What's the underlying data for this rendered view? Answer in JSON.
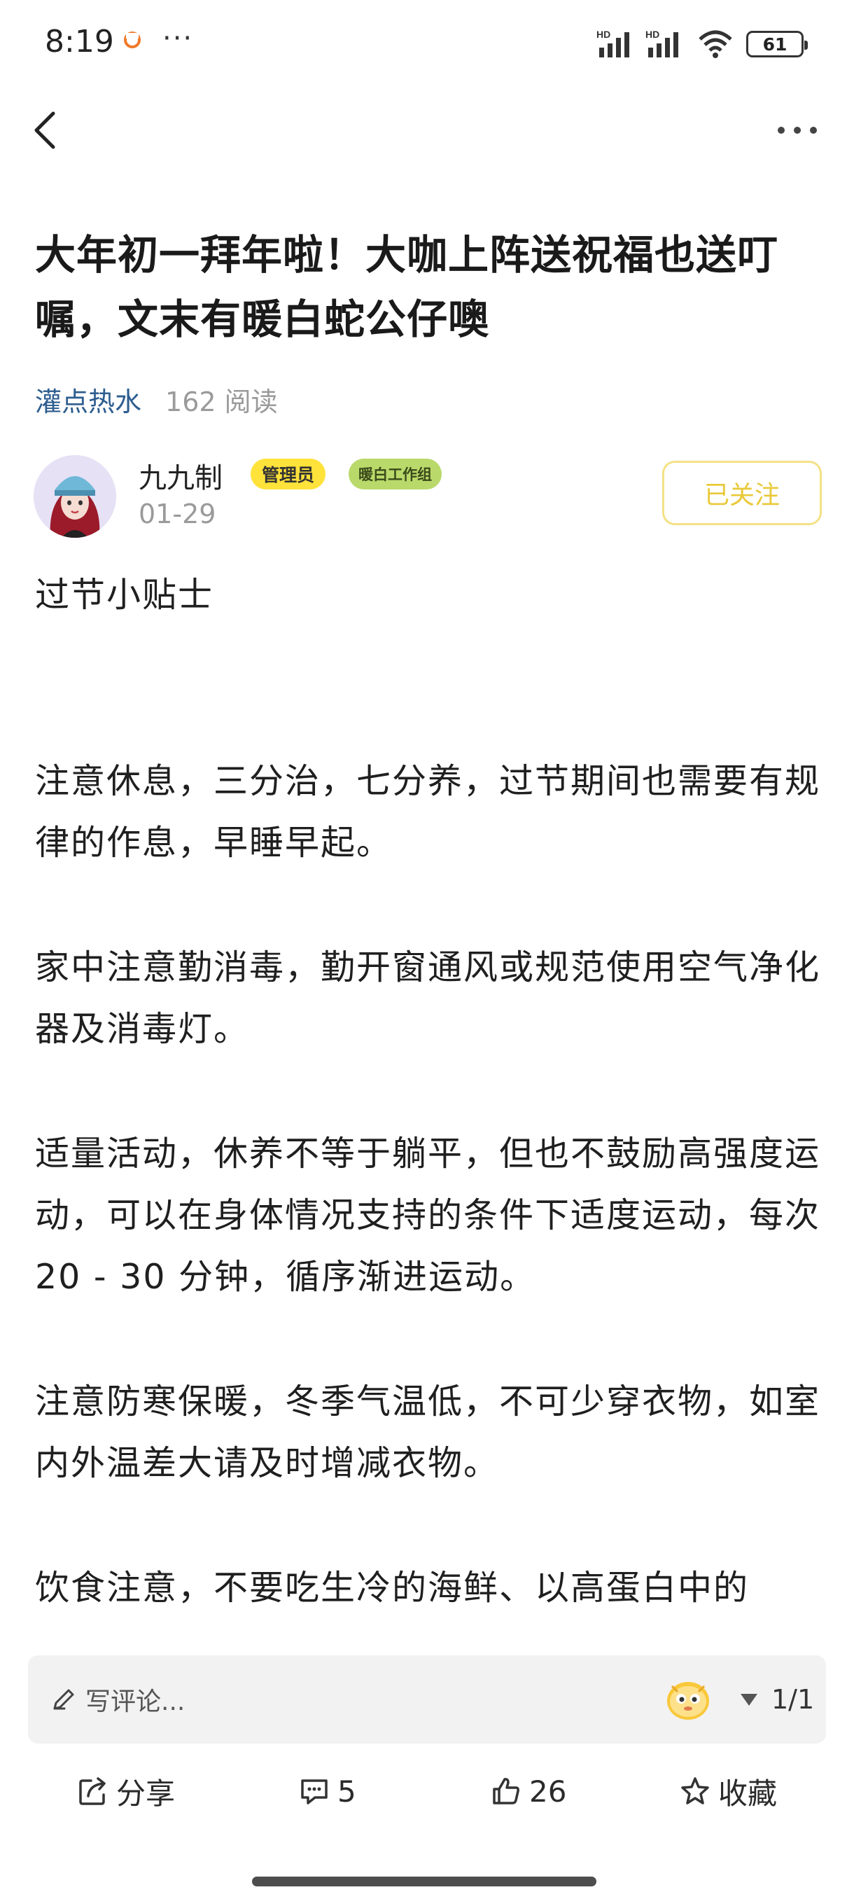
{
  "status_bar": {
    "time": "8:19",
    "more": "···",
    "battery": "61",
    "signal_label": "HD"
  },
  "header": {
    "back_icon": "chevron-left-icon",
    "more_icon": "more-dots-icon"
  },
  "article": {
    "title": "大年初一拜年啦！大咖上阵送祝福也送叮嘱，文末有暖白蛇公仔噢",
    "category": "灌点热水",
    "read_count": "162 阅读",
    "author": {
      "name": "九九制",
      "badge_admin": "管理员",
      "badge_group": "暖白工作组",
      "date": "01-29",
      "follow_label": "已关注"
    },
    "paragraphs": [
      "过节小贴士",
      "注意休息，三分治，七分养，过节期间也需要有规律的作息，早睡早起。",
      "家中注意勤消毒，勤开窗通风或规范使用空气净化器及消毒灯。",
      "适量活动，休养不等于躺平，但也不鼓励高强度运动，可以在身体情况支持的条件下适度运动，每次 20 - 30 分钟，循序渐进运动。",
      "注意防寒保暖，冬季气温低，不可少穿衣物，如室内外温差大请及时增减衣物。",
      "饮食注意，不要吃生冷的海鲜、以高蛋白中的"
    ]
  },
  "comment_bar": {
    "placeholder": "写评论...",
    "page": "1/1"
  },
  "actions": {
    "share": "分享",
    "comments": "5",
    "likes": "26",
    "favorite": "收藏"
  },
  "colors": {
    "link": "#2d5d8f",
    "admin_badge": "#ffe23a",
    "group_badge": "#b9d96a",
    "follow_border": "#f4e186"
  }
}
